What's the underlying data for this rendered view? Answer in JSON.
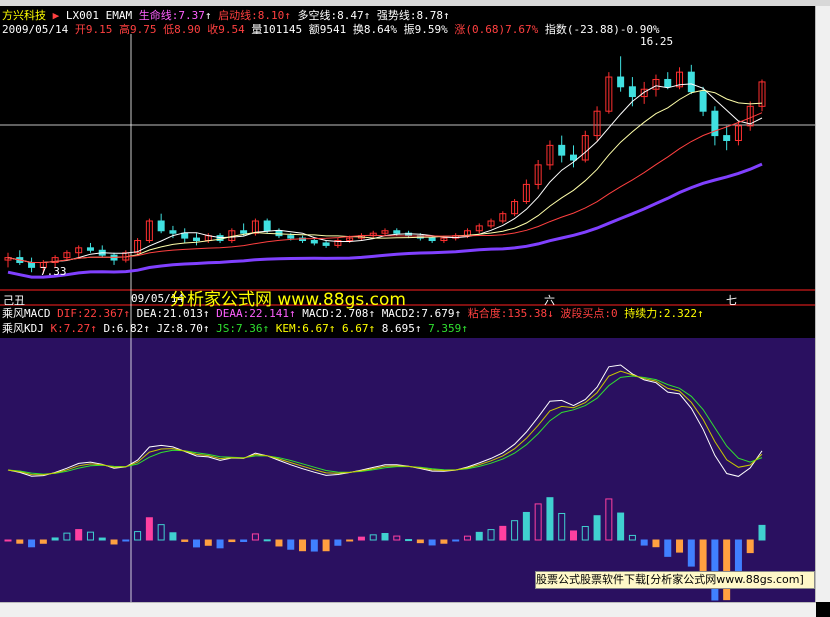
{
  "stock": {
    "name": "方兴科技",
    "indicator": "LX001",
    "ema_name": "EMAM",
    "lifeline": "生命线:7.37",
    "startline": "启动线:8.10",
    "longline": "多空线:8.47",
    "strongline": "强势线:8.78"
  },
  "quote": {
    "date": "2009/05/14",
    "open": "开9.15",
    "high": "高9.75",
    "low": "低8.90",
    "close": "收9.54",
    "volume": "量101145",
    "amount": "额9541",
    "turnover": "换8.64%",
    "amplitude": "振9.59%",
    "change": "涨(0.68)7.67%",
    "index": "指数(-23.88)-0.90%"
  },
  "price_annotations": {
    "high": "16.25",
    "low": "7.33"
  },
  "axis_labels": {
    "left": "己丑",
    "cursor_date": "09/05/14",
    "mid": "六",
    "right": "七"
  },
  "watermark": "分析家公式网 www.88gs.com",
  "macd_panel": {
    "title": "乘风MACD",
    "dif": "DIF:22.367",
    "dea": "DEA:21.013",
    "deaa": "DEAA:22.141",
    "macd": "MACD:2.708",
    "macd2": "MACD2:7.679",
    "stick": "粘合度:135.38",
    "band": "波段买点:0",
    "hold": "持续力:2.322"
  },
  "kdj_panel": {
    "title": "乘风KDJ",
    "k": "K:7.27",
    "d": "D:6.82",
    "jz": "JZ:8.70",
    "js": "JS:7.36",
    "kem": "KEM:6.67",
    "v1": "6.67",
    "v2": "8.695",
    "v3": "7.359"
  },
  "ad_text": "股票公式股票软件下载[分析家公式网www.88gs.com]",
  "colors": {
    "up": "#ff3030",
    "down": "#40e0e0",
    "ma_purple": "#8040ff",
    "panel_bg": "#2a1060"
  },
  "chart_data": {
    "type": "candlestick",
    "ohlc": [
      [
        7.9,
        8.2,
        7.6,
        8.0
      ],
      [
        8.0,
        8.3,
        7.7,
        7.8
      ],
      [
        7.8,
        8.0,
        7.4,
        7.6
      ],
      [
        7.6,
        7.9,
        7.33,
        7.8
      ],
      [
        7.8,
        8.1,
        7.6,
        8.0
      ],
      [
        8.0,
        8.3,
        7.9,
        8.2
      ],
      [
        8.2,
        8.5,
        8.0,
        8.4
      ],
      [
        8.4,
        8.6,
        8.2,
        8.3
      ],
      [
        8.3,
        8.5,
        8.0,
        8.1
      ],
      [
        8.1,
        8.2,
        7.7,
        7.9
      ],
      [
        7.9,
        8.3,
        7.8,
        8.2
      ],
      [
        8.2,
        8.8,
        8.1,
        8.7
      ],
      [
        8.7,
        9.6,
        8.6,
        9.5
      ],
      [
        9.5,
        9.8,
        9.0,
        9.1
      ],
      [
        9.1,
        9.3,
        8.8,
        9.0
      ],
      [
        9.0,
        9.2,
        8.6,
        8.8
      ],
      [
        8.8,
        9.0,
        8.5,
        8.7
      ],
      [
        8.7,
        9.0,
        8.6,
        8.9
      ],
      [
        8.9,
        9.0,
        8.6,
        8.7
      ],
      [
        8.7,
        9.2,
        8.6,
        9.1
      ],
      [
        9.1,
        9.4,
        8.9,
        9.0
      ],
      [
        9.0,
        9.6,
        8.9,
        9.5
      ],
      [
        9.5,
        9.6,
        9.0,
        9.1
      ],
      [
        9.1,
        9.2,
        8.8,
        8.9
      ],
      [
        8.9,
        9.0,
        8.7,
        8.8
      ],
      [
        8.8,
        8.9,
        8.6,
        8.7
      ],
      [
        8.7,
        8.8,
        8.5,
        8.6
      ],
      [
        8.6,
        8.7,
        8.4,
        8.5
      ],
      [
        8.5,
        8.8,
        8.4,
        8.7
      ],
      [
        8.7,
        8.9,
        8.6,
        8.8
      ],
      [
        8.8,
        9.0,
        8.7,
        8.9
      ],
      [
        8.9,
        9.1,
        8.8,
        9.0
      ],
      [
        9.0,
        9.2,
        8.9,
        9.1
      ],
      [
        9.1,
        9.2,
        8.9,
        9.0
      ],
      [
        9.0,
        9.1,
        8.8,
        8.9
      ],
      [
        8.9,
        9.0,
        8.7,
        8.8
      ],
      [
        8.8,
        8.9,
        8.6,
        8.7
      ],
      [
        8.7,
        8.9,
        8.6,
        8.8
      ],
      [
        8.8,
        9.0,
        8.7,
        8.9
      ],
      [
        8.9,
        9.2,
        8.8,
        9.1
      ],
      [
        9.1,
        9.4,
        9.0,
        9.3
      ],
      [
        9.3,
        9.6,
        9.2,
        9.5
      ],
      [
        9.5,
        9.9,
        9.4,
        9.8
      ],
      [
        9.8,
        10.4,
        9.7,
        10.3
      ],
      [
        10.3,
        11.2,
        10.2,
        11.0
      ],
      [
        11.0,
        12.0,
        10.8,
        11.8
      ],
      [
        11.8,
        12.8,
        11.6,
        12.6
      ],
      [
        12.6,
        13.0,
        11.9,
        12.2
      ],
      [
        12.2,
        12.6,
        11.7,
        12.0
      ],
      [
        12.0,
        13.2,
        11.9,
        13.0
      ],
      [
        13.0,
        14.2,
        12.8,
        14.0
      ],
      [
        14.0,
        15.6,
        13.9,
        15.4
      ],
      [
        15.4,
        16.25,
        14.8,
        15.0
      ],
      [
        15.0,
        15.4,
        14.2,
        14.6
      ],
      [
        14.6,
        15.2,
        14.3,
        14.9
      ],
      [
        14.9,
        15.5,
        14.6,
        15.3
      ],
      [
        15.3,
        15.6,
        14.9,
        15.0
      ],
      [
        15.0,
        15.8,
        14.9,
        15.6
      ],
      [
        15.6,
        15.9,
        14.7,
        14.8
      ],
      [
        14.8,
        15.0,
        13.8,
        14.0
      ],
      [
        14.0,
        14.2,
        12.6,
        13.0
      ],
      [
        13.0,
        13.4,
        12.4,
        12.8
      ],
      [
        12.8,
        13.6,
        12.6,
        13.4
      ],
      [
        13.4,
        14.4,
        13.2,
        14.2
      ],
      [
        14.2,
        15.3,
        14.0,
        15.2
      ]
    ],
    "ylim": [
      7.0,
      17.0
    ],
    "series": [
      {
        "name": "生命线",
        "color": "#ffffff"
      },
      {
        "name": "启动线",
        "color": "#ff4040"
      },
      {
        "name": "多空线",
        "color": "#ffffff"
      },
      {
        "name": "强势线",
        "color": "#8040ff"
      }
    ]
  }
}
